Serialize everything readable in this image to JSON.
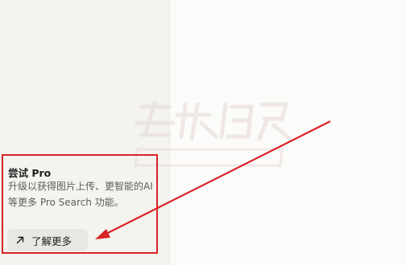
{
  "promo": {
    "title": "尝试 Pro",
    "description": "升级以获得图片上传、更智能的AI等更多 Pro Search 功能。",
    "button_label": "了解更多",
    "button_icon": "arrow-up-right-icon"
  },
  "colors": {
    "annotation": "#d92327",
    "sidebar_bg": "#f3f3ef",
    "main_bg": "#fbfbf9",
    "button_bg": "#e8e8e3"
  }
}
